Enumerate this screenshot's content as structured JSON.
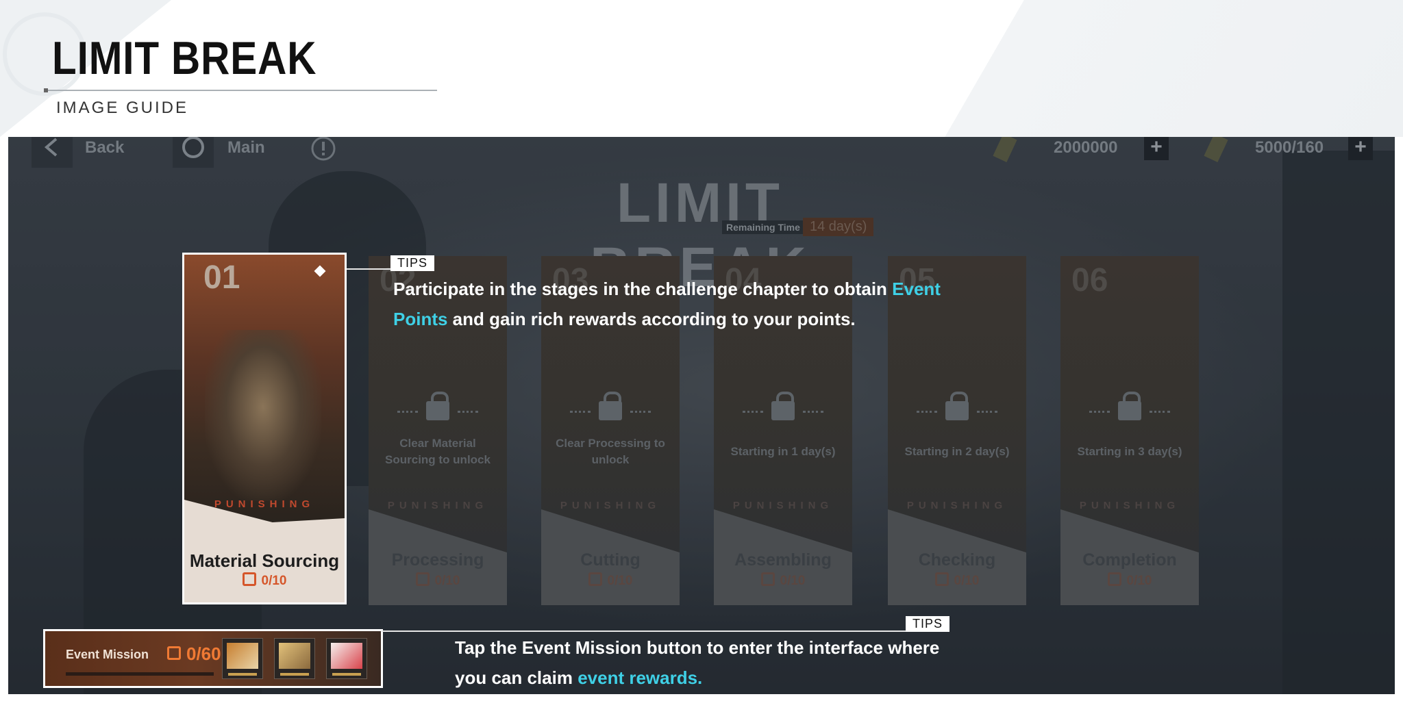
{
  "guide": {
    "title": "LIMIT BREAK",
    "subtitle": "IMAGE GUIDE"
  },
  "topbar": {
    "back_label": "Back",
    "main_label": "Main",
    "currency_1": "2000000",
    "currency_2": "5000/160",
    "plus": "+"
  },
  "event": {
    "banner_title": "LIMIT BREAK",
    "remaining_label": "Remaining Time",
    "remaining_value": "14 day(s)"
  },
  "stages": [
    {
      "number": "01",
      "name": "Material Sourcing",
      "progress": "0/10",
      "status": "",
      "brand": "PUNISHING",
      "locked": false
    },
    {
      "number": "02",
      "name": "Processing",
      "progress": "0/10",
      "status": "Clear Material Sourcing to unlock",
      "brand": "PUNISHING",
      "locked": true
    },
    {
      "number": "03",
      "name": "Cutting",
      "progress": "0/10",
      "status": "Clear Processing to unlock",
      "brand": "PUNISHING",
      "locked": true
    },
    {
      "number": "04",
      "name": "Assembling",
      "progress": "0/10",
      "status": "Starting in 1 day(s)",
      "brand": "PUNISHING",
      "locked": true
    },
    {
      "number": "05",
      "name": "Checking",
      "progress": "0/10",
      "status": "Starting in 2 day(s)",
      "brand": "PUNISHING",
      "locked": true
    },
    {
      "number": "06",
      "name": "Completion",
      "progress": "0/10",
      "status": "Starting in 3 day(s)",
      "brand": "PUNISHING",
      "locked": true
    }
  ],
  "tips_1": {
    "tag": "TIPS",
    "text_a": "Participate in the stages in the challenge chapter to obtain ",
    "highlight": "Event Points",
    "text_b": " and gain rich rewards according to your points."
  },
  "tips_2": {
    "tag": "TIPS",
    "text_a": "Tap the Event Mission button to enter the interface where you can claim ",
    "highlight": "event rewards."
  },
  "mission": {
    "label": "Event Mission",
    "count": "0/60"
  },
  "colors": {
    "highlight": "#3fd0e6",
    "accent_orange": "#f07a34",
    "brand_red": "#c0492e"
  }
}
